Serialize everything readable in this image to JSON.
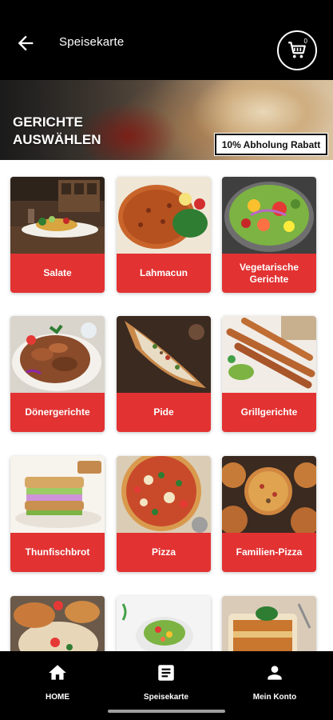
{
  "header": {
    "title": "Speisekarte",
    "cart_count": "0"
  },
  "banner": {
    "title": "GERICHTE AUSWÄHLEN",
    "badge": "10% Abholung Rabatt"
  },
  "categories": [
    {
      "label": "Salate"
    },
    {
      "label": "Lahmacun"
    },
    {
      "label": "Vegetarische Gerichte"
    },
    {
      "label": "Dönergerichte"
    },
    {
      "label": "Pide"
    },
    {
      "label": "Grillgerichte"
    },
    {
      "label": "Thunfischbrot"
    },
    {
      "label": "Pizza"
    },
    {
      "label": "Familien-Pizza"
    },
    {
      "label": ""
    },
    {
      "label": ""
    },
    {
      "label": ""
    }
  ],
  "bottom_nav": {
    "items": [
      {
        "label": "HOME",
        "icon": "home-icon"
      },
      {
        "label": "Speisekarte",
        "icon": "menu-icon"
      },
      {
        "label": "Mein Konto",
        "icon": "account-icon"
      }
    ]
  },
  "colors": {
    "accent": "#e23232",
    "header_bg": "#000000",
    "nav_bg": "#000000"
  }
}
